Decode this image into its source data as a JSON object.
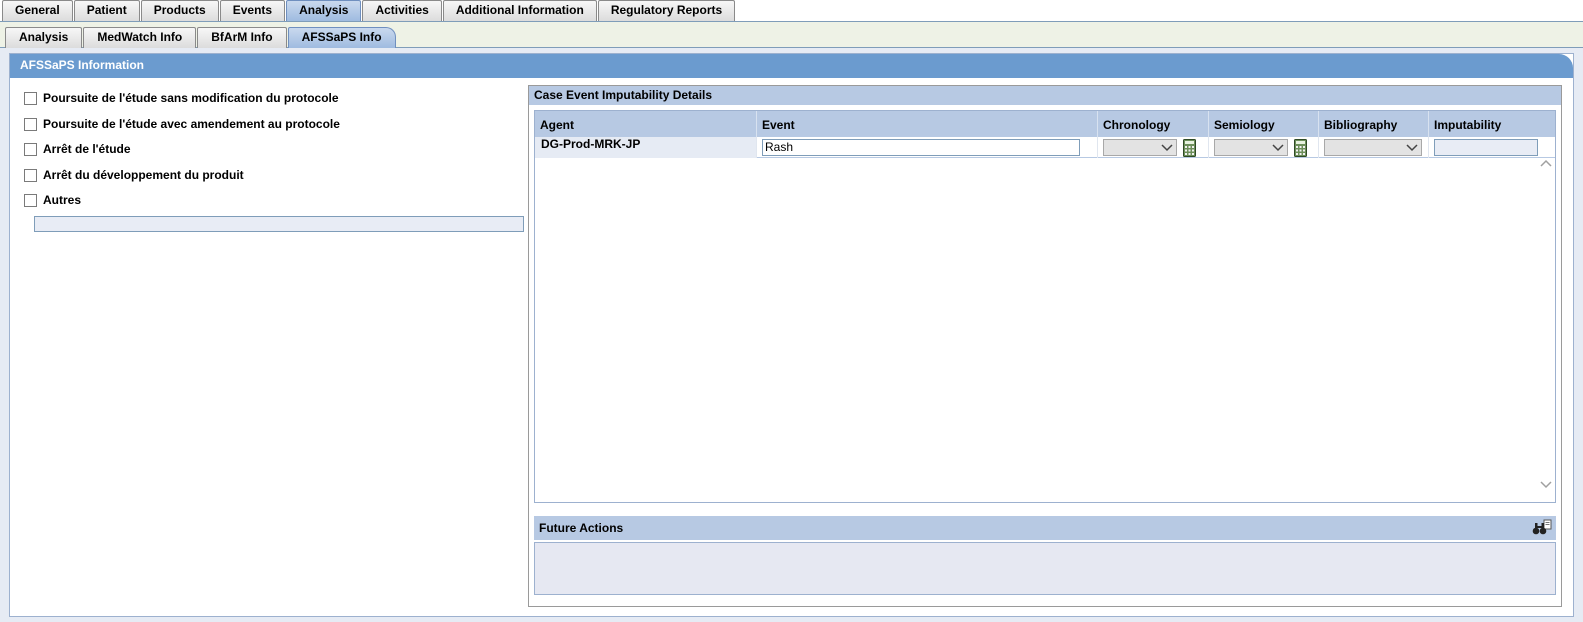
{
  "main_tabs": [
    "General",
    "Patient",
    "Products",
    "Events",
    "Analysis",
    "Activities",
    "Additional Information",
    "Regulatory Reports"
  ],
  "sub_tabs": [
    "Analysis",
    "MedWatch Info",
    "BfArM Info",
    "AFSSaPS Info"
  ],
  "panel": {
    "title": "AFSSaPS Information"
  },
  "options": {
    "opt1": "Poursuite de l'étude sans modification du protocole",
    "opt2": "Poursuite de l'étude avec amendement au protocole",
    "opt3": "Arrêt de l'étude",
    "opt4": "Arrêt du développement du produit",
    "opt5": "Autres"
  },
  "autres_value": "",
  "imputability": {
    "title": "Case Event Imputability Details",
    "columns": {
      "agent": "Agent",
      "event": "Event",
      "chronology": "Chronology",
      "semiology": "Semiology",
      "bibliography": "Bibliography",
      "imputability": "Imputability"
    },
    "row": {
      "agent": "DG-Prod-MRK-JP",
      "event": "Rash",
      "chronology": "",
      "semiology": "",
      "bibliography": "",
      "imputability": ""
    }
  },
  "future_actions": {
    "title": "Future Actions",
    "value": ""
  },
  "colors": {
    "header_blue": "#6b9bcf",
    "grid_header": "#b7c9e3",
    "active_tab": "#9fbbe0"
  }
}
